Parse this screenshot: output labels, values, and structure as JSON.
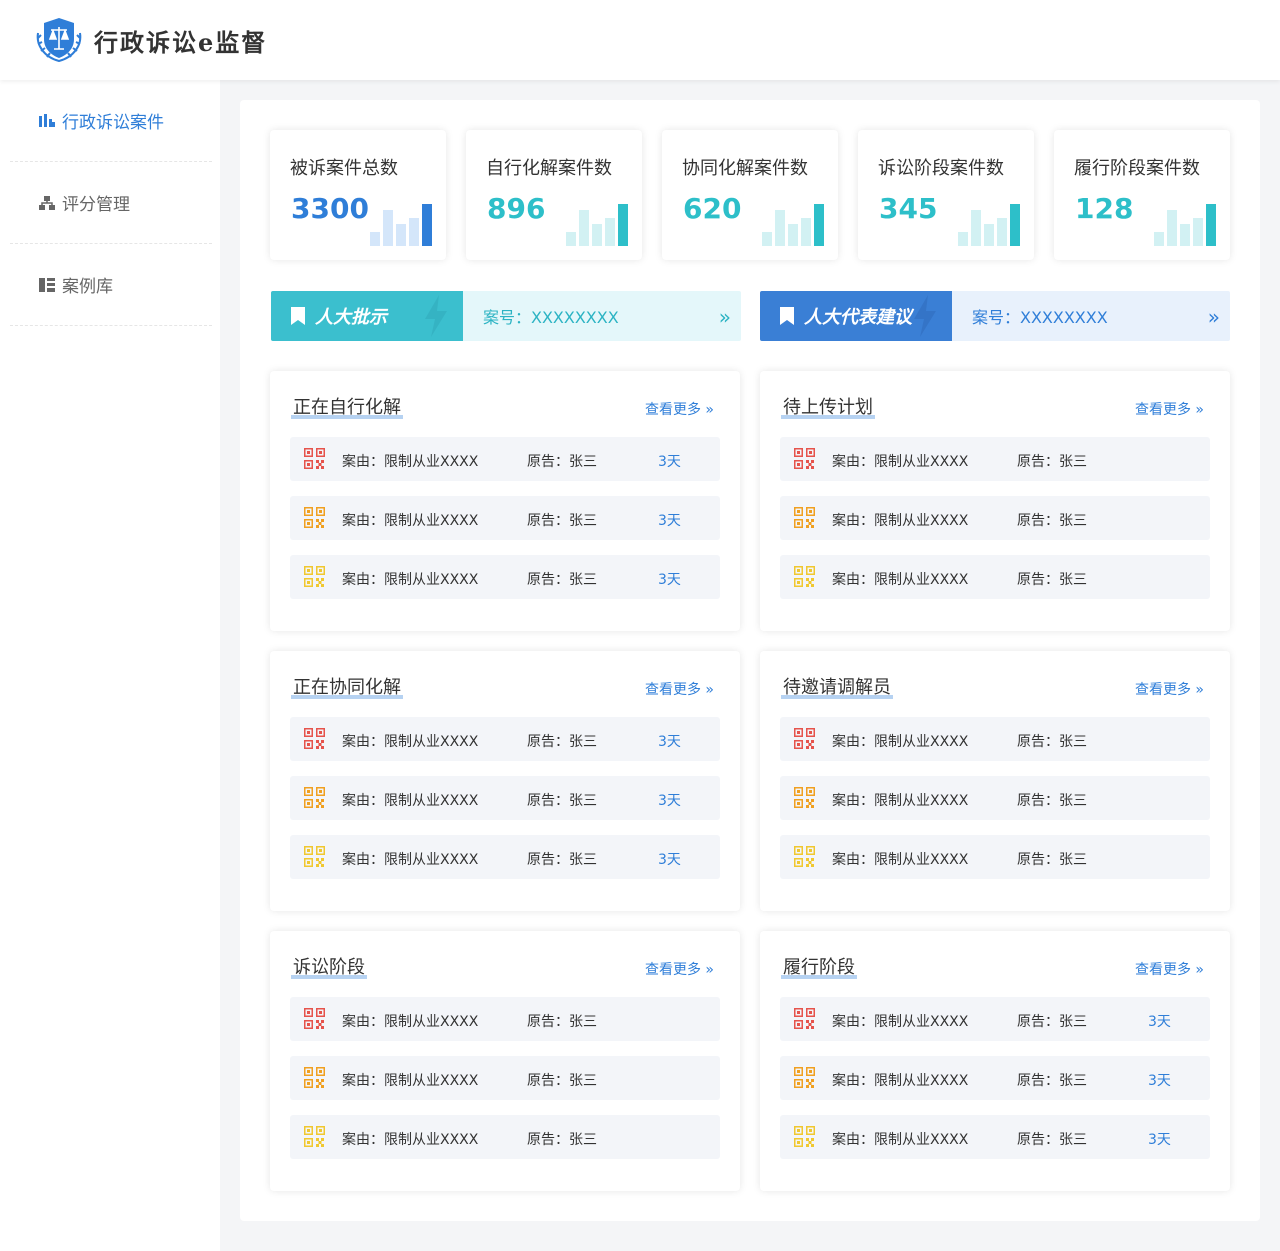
{
  "header": {
    "app_title": "行政诉讼e监督",
    "logo_icon": "shield-scales-icon"
  },
  "sidebar": {
    "items": [
      {
        "label": "行政诉讼案件",
        "icon": "bar-chart-icon",
        "active": true
      },
      {
        "label": "评分管理",
        "icon": "hierarchy-icon",
        "active": false
      },
      {
        "label": "案例库",
        "icon": "library-icon",
        "active": false
      }
    ]
  },
  "stats": [
    {
      "label": "被诉案件总数",
      "value": "3300",
      "color": "#2f7ed8"
    },
    {
      "label": "自行化解案件数",
      "value": "896",
      "color": "#2dbfc9"
    },
    {
      "label": "协同化解案件数",
      "value": "620",
      "color": "#2dbfc9"
    },
    {
      "label": "诉讼阶段案件数",
      "value": "345",
      "color": "#2dbfc9"
    },
    {
      "label": "履行阶段案件数",
      "value": "128",
      "color": "#2dbfc9"
    }
  ],
  "banners": [
    {
      "tag": "人大批示",
      "case_no": "案号：XXXXXXXX",
      "tag_color": "#3bbfce",
      "body_bg": "#e4f7fa",
      "text_color": "#2bb3c3"
    },
    {
      "tag": "人大代表建议",
      "case_no": "案号：XXXXXXXX",
      "tag_color": "#3a7fd5",
      "body_bg": "#e8f1fc",
      "text_color": "#2f7ed8"
    }
  ],
  "more_label": "查看更多",
  "panels": [
    {
      "title": "正在自行化解",
      "rows": [
        {
          "reason": "案由：限制从业XXXX",
          "plaintiff": "原告：张三",
          "days": "3天",
          "qr_color": "#e6534c"
        },
        {
          "reason": "案由：限制从业XXXX",
          "plaintiff": "原告：张三",
          "days": "3天",
          "qr_color": "#f0a020"
        },
        {
          "reason": "案由：限制从业XXXX",
          "plaintiff": "原告：张三",
          "days": "3天",
          "qr_color": "#f0c830"
        }
      ]
    },
    {
      "title": "待上传计划",
      "rows": [
        {
          "reason": "案由：限制从业XXXX",
          "plaintiff": "原告：张三",
          "days": "",
          "qr_color": "#e6534c"
        },
        {
          "reason": "案由：限制从业XXXX",
          "plaintiff": "原告：张三",
          "days": "",
          "qr_color": "#f0a020"
        },
        {
          "reason": "案由：限制从业XXXX",
          "plaintiff": "原告：张三",
          "days": "",
          "qr_color": "#f0c830"
        }
      ]
    },
    {
      "title": "正在协同化解",
      "rows": [
        {
          "reason": "案由：限制从业XXXX",
          "plaintiff": "原告：张三",
          "days": "3天",
          "qr_color": "#e6534c"
        },
        {
          "reason": "案由：限制从业XXXX",
          "plaintiff": "原告：张三",
          "days": "3天",
          "qr_color": "#f0a020"
        },
        {
          "reason": "案由：限制从业XXXX",
          "plaintiff": "原告：张三",
          "days": "3天",
          "qr_color": "#f0c830"
        }
      ]
    },
    {
      "title": "待邀请调解员",
      "rows": [
        {
          "reason": "案由：限制从业XXXX",
          "plaintiff": "原告：张三",
          "days": "",
          "qr_color": "#e6534c"
        },
        {
          "reason": "案由：限制从业XXXX",
          "plaintiff": "原告：张三",
          "days": "",
          "qr_color": "#f0a020"
        },
        {
          "reason": "案由：限制从业XXXX",
          "plaintiff": "原告：张三",
          "days": "",
          "qr_color": "#f0c830"
        }
      ]
    },
    {
      "title": "诉讼阶段",
      "rows": [
        {
          "reason": "案由：限制从业XXXX",
          "plaintiff": "原告：张三",
          "days": "",
          "qr_color": "#e6534c"
        },
        {
          "reason": "案由：限制从业XXXX",
          "plaintiff": "原告：张三",
          "days": "",
          "qr_color": "#f0a020"
        },
        {
          "reason": "案由：限制从业XXXX",
          "plaintiff": "原告：张三",
          "days": "",
          "qr_color": "#f0c830"
        }
      ]
    },
    {
      "title": "履行阶段",
      "rows": [
        {
          "reason": "案由：限制从业XXXX",
          "plaintiff": "原告：张三",
          "days": "3天",
          "qr_color": "#e6534c"
        },
        {
          "reason": "案由：限制从业XXXX",
          "plaintiff": "原告：张三",
          "days": "3天",
          "qr_color": "#f0a020"
        },
        {
          "reason": "案由：限制从业XXXX",
          "plaintiff": "原告：张三",
          "days": "3天",
          "qr_color": "#f0c830"
        }
      ]
    }
  ]
}
